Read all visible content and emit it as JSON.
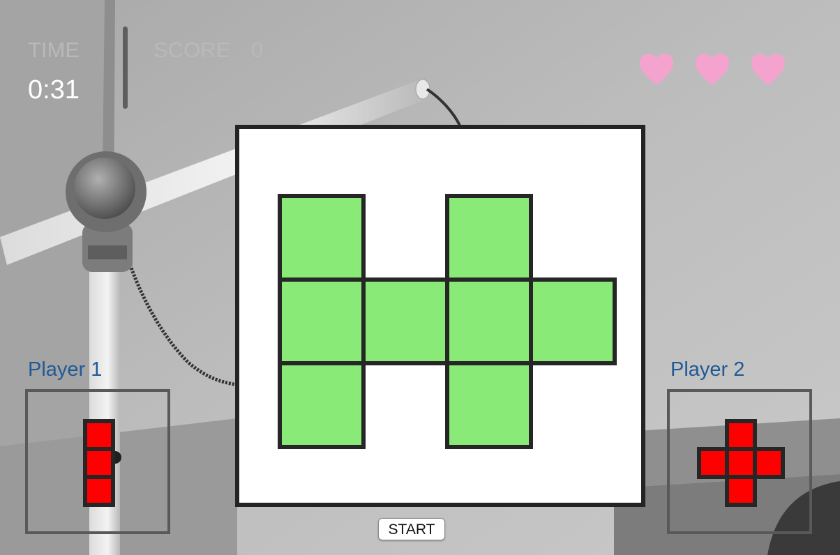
{
  "hud": {
    "time_label": "TIME",
    "time_value": "0:31",
    "score_label": "SCORE",
    "score_value": "0",
    "lives": 3,
    "heart_color": "#f4a3cf"
  },
  "board": {
    "cell_fill": "#8aea78",
    "cell_stroke": "#262626",
    "cells": [
      {
        "row": 0,
        "col": 0
      },
      {
        "row": 0,
        "col": 2
      },
      {
        "row": 1,
        "col": 0
      },
      {
        "row": 1,
        "col": 1
      },
      {
        "row": 1,
        "col": 2
      },
      {
        "row": 1,
        "col": 3
      },
      {
        "row": 2,
        "col": 0
      },
      {
        "row": 2,
        "col": 2
      }
    ]
  },
  "players": [
    {
      "label": "Player 1",
      "piece_color": "#ff0000",
      "piece_cells": [
        {
          "row": 0,
          "col": 0
        },
        {
          "row": 1,
          "col": 0
        },
        {
          "row": 2,
          "col": 0
        }
      ]
    },
    {
      "label": "Player 2",
      "piece_color": "#ff0000",
      "piece_cells": [
        {
          "row": 0,
          "col": 1
        },
        {
          "row": 1,
          "col": 0
        },
        {
          "row": 1,
          "col": 1
        },
        {
          "row": 1,
          "col": 2
        },
        {
          "row": 2,
          "col": 1
        }
      ]
    }
  ],
  "controls": {
    "start_label": "START"
  }
}
